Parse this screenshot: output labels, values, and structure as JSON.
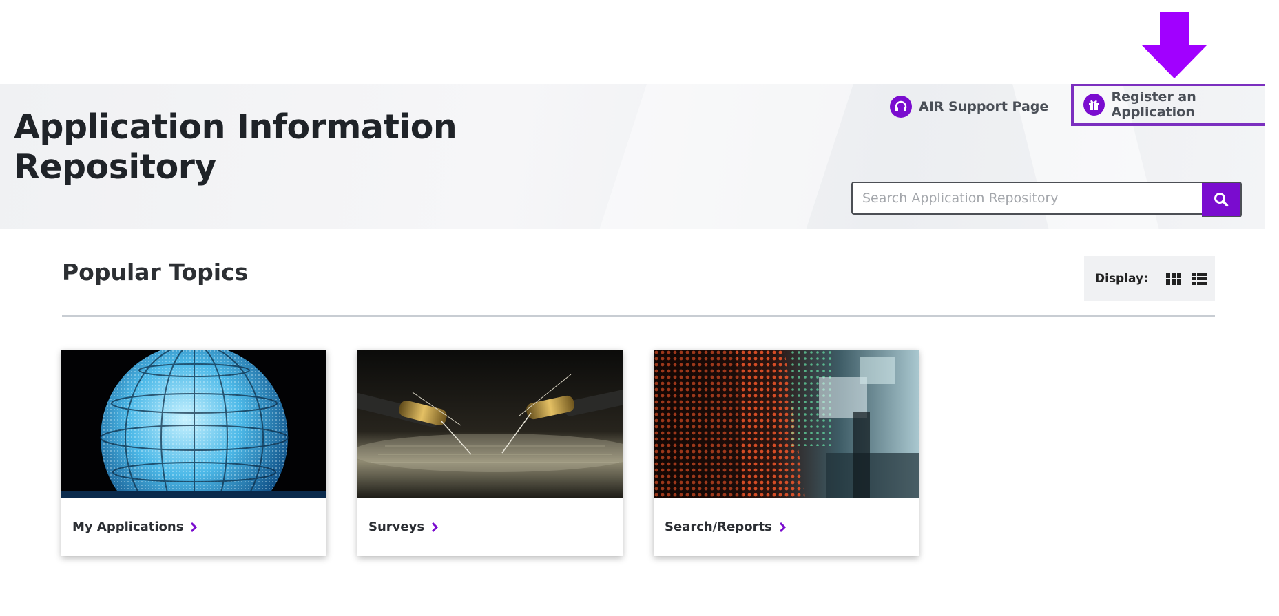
{
  "header": {
    "title": "Application Information Repository",
    "support_link": "AIR Support Page",
    "register_link": "Register an Application",
    "search_placeholder": "Search Application Repository"
  },
  "main": {
    "section_title": "Popular Topics",
    "display_label": "Display:",
    "cards": [
      {
        "label": "My Applications",
        "image": "globe-lights-image"
      },
      {
        "label": "Surveys",
        "image": "circuit-probe-image"
      },
      {
        "label": "Search/Reports",
        "image": "stock-ticker-image"
      }
    ]
  },
  "colors": {
    "accent": "#7a0ccf",
    "arrow": "#a100ff",
    "highlight_border": "#7b2fbf",
    "hero_bg": "#f0f1f3"
  },
  "icons": [
    "arrow-down-icon",
    "headset-icon",
    "gift-icon",
    "search-icon",
    "grid-view-icon",
    "list-view-icon",
    "chevron-right-icon"
  ]
}
